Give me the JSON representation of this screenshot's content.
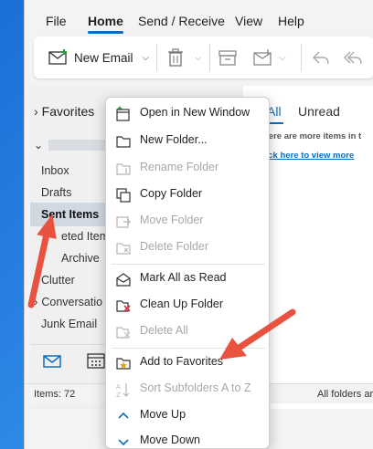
{
  "menu": {
    "tabs": [
      "File",
      "Home",
      "Send / Receive",
      "View",
      "Help"
    ]
  },
  "ribbon": {
    "new_email": "New Email"
  },
  "folders": {
    "favorites_label": "Favorites",
    "inbox": "Inbox",
    "drafts": "Drafts",
    "sent_items": "Sent Items",
    "deleted_items": "eted Item",
    "archive": "Archive",
    "clutter": "Clutter",
    "conversation": "Conversatio",
    "junk": "Junk Email"
  },
  "messages": {
    "tab_all": "All",
    "tab_unread": "Unread",
    "more_items": "here are more items in t",
    "click_here": "lick here to view more"
  },
  "status": {
    "items": "Items: 72",
    "folders": "All folders are"
  },
  "context_menu": {
    "items": [
      {
        "label": "Open in New Window",
        "disabled": false
      },
      {
        "label": "New Folder...",
        "disabled": false
      },
      {
        "label": "Rename Folder",
        "disabled": true
      },
      {
        "label": "Copy Folder",
        "disabled": false
      },
      {
        "label": "Move Folder",
        "disabled": true
      },
      {
        "label": "Delete Folder",
        "disabled": true
      },
      {
        "label": "Mark All as Read",
        "disabled": false
      },
      {
        "label": "Clean Up Folder",
        "disabled": false
      },
      {
        "label": "Delete All",
        "disabled": true
      },
      {
        "label": "Add to Favorites",
        "disabled": false
      },
      {
        "label": "Sort Subfolders A to Z",
        "disabled": true
      },
      {
        "label": "Move Up",
        "disabled": false
      },
      {
        "label": "Move Down",
        "disabled": false
      }
    ]
  },
  "colors": {
    "accent": "#0f6cbd",
    "annotation_arrow": "#e8523f",
    "disabled_text": "#a8a8a8"
  }
}
